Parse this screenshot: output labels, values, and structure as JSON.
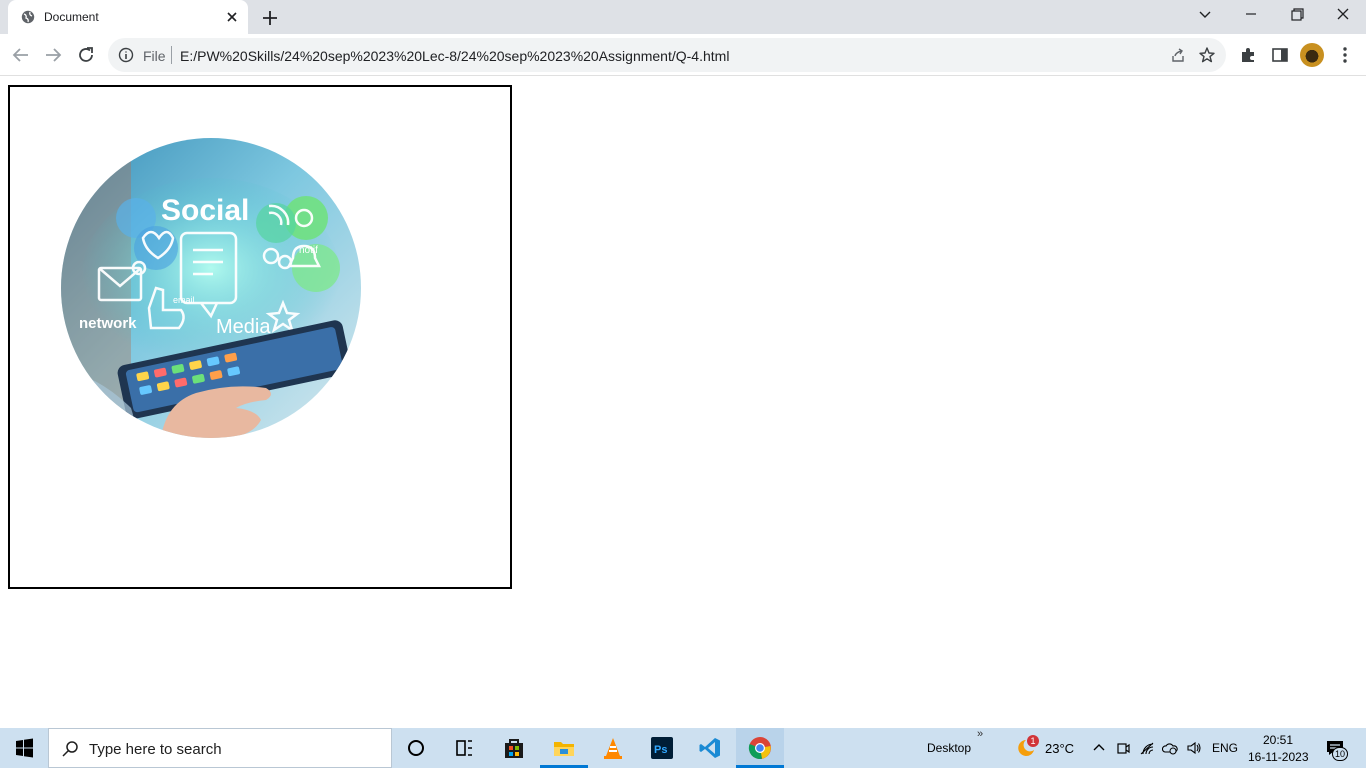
{
  "browser": {
    "tab": {
      "title": "Document"
    },
    "omnibox": {
      "scheme_label": "File",
      "url": "E:/PW%20Skills/24%20sep%2023%20Lec-8/24%20sep%2023%20Assignment/Q-4.html"
    }
  },
  "page": {
    "image": {
      "alt_words": [
        "Social",
        "Media",
        "network",
        "email",
        "internet",
        "notif"
      ],
      "shape": "circle"
    }
  },
  "taskbar": {
    "search_placeholder": "Type here to search",
    "desktop_label": "Desktop",
    "weather": {
      "temp": "23°C",
      "badge": "1"
    },
    "language": "ENG",
    "clock": {
      "time": "20:51",
      "date": "16-11-2023"
    },
    "notifications_count": "10"
  },
  "colors": {
    "tabstrip": "#dee1e6",
    "omnibox": "#f1f3f4",
    "taskbar": "#cde0f0",
    "accent": "#0078d4"
  }
}
